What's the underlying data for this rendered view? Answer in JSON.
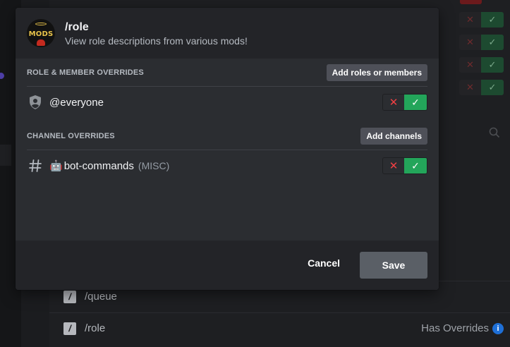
{
  "background": {
    "commands": [
      {
        "name": "/queue",
        "status": ""
      },
      {
        "name": "/role",
        "status": "Has Overrides"
      }
    ],
    "info_icon": "info-icon",
    "toggle_deny_glyph": "✕",
    "toggle_allow_glyph": "✓"
  },
  "modal": {
    "title": "/role",
    "description": "View role descriptions from various mods!",
    "avatar_text": "MODS",
    "role_section": {
      "label": "ROLE & MEMBER OVERRIDES",
      "button": "Add roles or members",
      "items": [
        {
          "icon": "shield-icon",
          "name": "@everyone",
          "state": "allow"
        }
      ]
    },
    "channel_section": {
      "label": "CHANNEL OVERRIDES",
      "button": "Add channels",
      "items": [
        {
          "icon": "hash-icon",
          "emoji": "🤖",
          "name": "bot-commands",
          "category": "(MISC)",
          "state": "allow"
        }
      ]
    },
    "footer": {
      "cancel": "Cancel",
      "save": "Save"
    }
  },
  "colors": {
    "allow": "#23a55a",
    "deny": "#f23f43",
    "modal_bg": "#2b2d31",
    "header_bg": "#232428"
  }
}
